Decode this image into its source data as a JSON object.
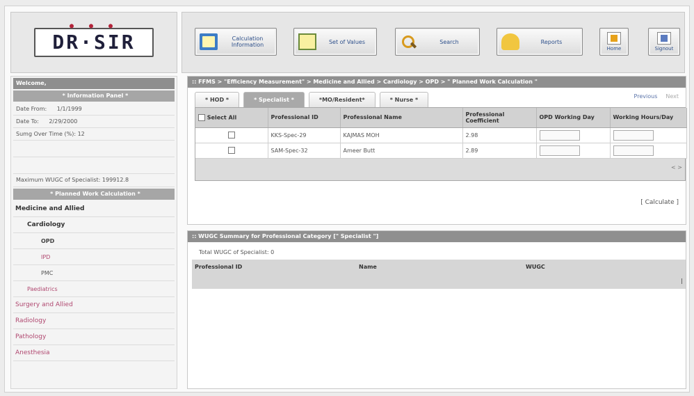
{
  "logo": {
    "text": "DR·SIR",
    "dots": "● ● ●"
  },
  "toolbar": {
    "calc_info": "Calculation Information",
    "set_values": "Set of Values",
    "search": "Search",
    "reports": "Reports",
    "home": "Home",
    "signout": "Signout"
  },
  "sidebar": {
    "welcome": "Welcome,",
    "info_panel": "* Information Panel *",
    "date_from_label": "Date From:",
    "date_from": "1/1/1999",
    "date_to_label": "Date To:",
    "date_to": "2/29/2000",
    "sumg_label": "Sumg Over Time (%):",
    "sumg_value": "12",
    "max_wugc": "Maximum WUGC of Specialist: 199912.8",
    "planned_work": "* Planned Work Calculation *",
    "tree": {
      "medicine": "Medicine and Allied",
      "cardiology": "Cardiology",
      "opd": "OPD",
      "ipd": "IPD",
      "pmc": "PMC",
      "paediatrics": "Paediatrics",
      "surgery": "Surgery and Allied",
      "radiology": "Radiology",
      "pathology": "Pathology",
      "anesthesia": "Anesthesia"
    }
  },
  "upper_panel": {
    "breadcrumb": ":: FFMS > \"Efficiency Measurement\" > Medicine and Allied > Cardiology > OPD > \" Planned Work Calculation \"",
    "tabs": [
      "* HOD *",
      "* Specialist *",
      "*MO/Resident*",
      "* Nurse *"
    ],
    "previous": "Previous",
    "next": "Next",
    "select_all": "Select All",
    "columns": {
      "professional_id": "Professional ID",
      "professional_name": "Professional Name",
      "coefficient": "Professional Coefficient",
      "opd_days": "OPD Working Day",
      "hours": "Working Hours/Day"
    },
    "rows": [
      {
        "id": "KKS-Spec-29",
        "name": "KAJMAS MOH",
        "coefficient": "2.98"
      },
      {
        "id": "SAM-Spec-32",
        "name": "Ameer Butt",
        "coefficient": "2.89"
      }
    ],
    "scroll_hint": "< >",
    "calculate": "[ Calculate ]"
  },
  "lower_panel": {
    "title": ":: WUGC Summary for Professional Category [\" Specialist \"]",
    "total": "Total WUGC of Specialist: 0",
    "col_id": "Professional ID",
    "col_name": "Name",
    "col_wugc": "WUGC",
    "scroll_mark": "|"
  }
}
